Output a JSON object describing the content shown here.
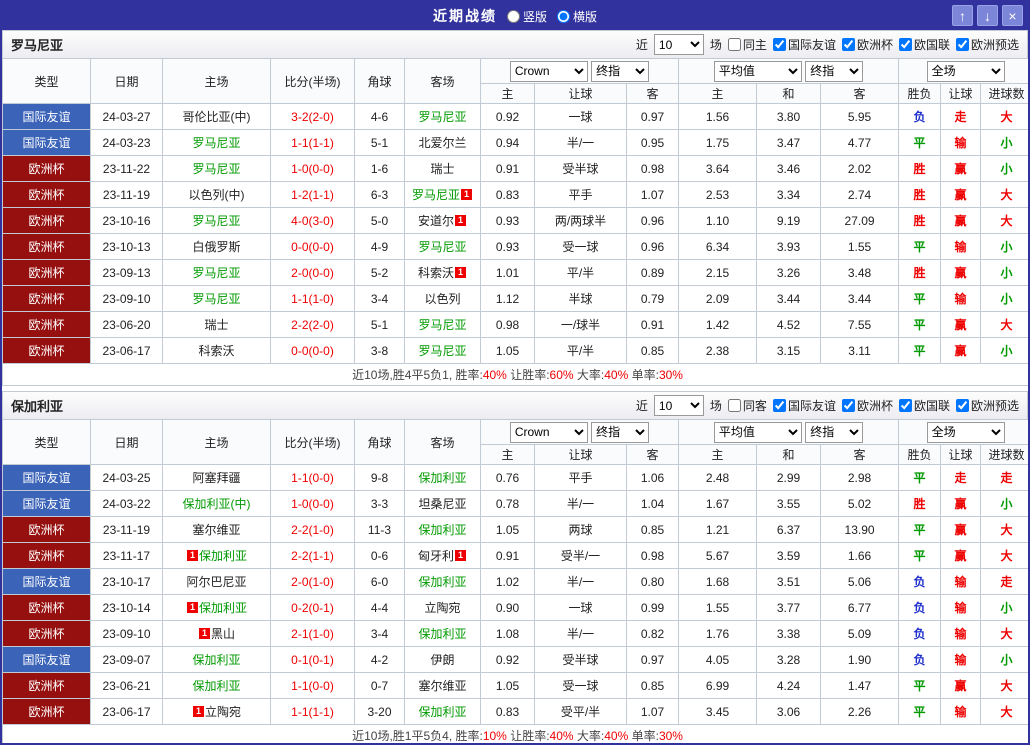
{
  "colors": {
    "topbar_bg": "#32329E",
    "accent_red": "#EE0000",
    "accent_green": "#009900",
    "accent_blue": "#2233CC",
    "type_friendly_bg": "#3B63B8",
    "type_euro_bg": "#971010",
    "team_highlight": "#009900"
  },
  "topbar": {
    "title": "近期战绩",
    "layout_options": [
      {
        "label": "竖版",
        "selected": false
      },
      {
        "label": "横版",
        "selected": true
      }
    ],
    "buttons": {
      "up": "↑",
      "down": "↓",
      "close": "×"
    }
  },
  "table_header": {
    "type": "类型",
    "date": "日期",
    "home": "主场",
    "score": "比分(半场)",
    "corner": "角球",
    "away": "客场",
    "odds_provider": "Crown",
    "odds_stage": "终指",
    "avg": "平均值",
    "avg_stage": "终指",
    "scope": "全场",
    "sub": [
      "主",
      "让球",
      "客",
      "主",
      "和",
      "客",
      "胜负",
      "让球",
      "进球数"
    ]
  },
  "sections": [
    {
      "team": "罗马尼亚",
      "filter": {
        "near": "近",
        "count": "10",
        "games": "场",
        "same": "同主",
        "same_checked": false,
        "comps": [
          {
            "label": "国际友谊",
            "checked": true
          },
          {
            "label": "欧洲杯",
            "checked": true
          },
          {
            "label": "欧国联",
            "checked": true
          },
          {
            "label": "欧洲预选",
            "checked": true
          }
        ]
      },
      "rows": [
        {
          "type": "国际友谊",
          "ts": "friendly",
          "date": "24-03-27",
          "home": {
            "n": "哥伦比亚(中)"
          },
          "score": "3-2(2-0)",
          "corner": "4-6",
          "away": {
            "n": "罗马尼亚",
            "hl": true
          },
          "odds": [
            "0.92",
            "一球",
            "0.97"
          ],
          "avg": [
            "1.56",
            "3.80",
            "5.95"
          ],
          "res": [
            [
              "负",
              "blue"
            ],
            [
              "走",
              "red"
            ],
            [
              "大",
              "red"
            ]
          ]
        },
        {
          "type": "国际友谊",
          "ts": "friendly",
          "date": "24-03-23",
          "home": {
            "n": "罗马尼亚",
            "hl": true
          },
          "score": "1-1(1-1)",
          "corner": "5-1",
          "away": {
            "n": "北爱尔兰"
          },
          "odds": [
            "0.94",
            "半/一",
            "0.95"
          ],
          "avg": [
            "1.75",
            "3.47",
            "4.77"
          ],
          "res": [
            [
              "平",
              "green"
            ],
            [
              "输",
              "red"
            ],
            [
              "小",
              "green"
            ]
          ]
        },
        {
          "type": "欧洲杯",
          "ts": "euro",
          "date": "23-11-22",
          "home": {
            "n": "罗马尼亚",
            "hl": true
          },
          "score": "1-0(0-0)",
          "corner": "1-6",
          "away": {
            "n": "瑞士"
          },
          "odds": [
            "0.91",
            "受半球",
            "0.98"
          ],
          "avg": [
            "3.64",
            "3.46",
            "2.02"
          ],
          "res": [
            [
              "胜",
              "red"
            ],
            [
              "赢",
              "red"
            ],
            [
              "小",
              "green"
            ]
          ]
        },
        {
          "type": "欧洲杯",
          "ts": "euro",
          "date": "23-11-19",
          "home": {
            "n": "以色列(中)"
          },
          "score": "1-2(1-1)",
          "corner": "6-3",
          "away": {
            "n": "罗马尼亚",
            "hl": true,
            "post": true
          },
          "odds": [
            "0.83",
            "平手",
            "1.07"
          ],
          "avg": [
            "2.53",
            "3.34",
            "2.74"
          ],
          "res": [
            [
              "胜",
              "red"
            ],
            [
              "赢",
              "red"
            ],
            [
              "大",
              "red"
            ]
          ]
        },
        {
          "type": "欧洲杯",
          "ts": "euro",
          "date": "23-10-16",
          "home": {
            "n": "罗马尼亚",
            "hl": true
          },
          "score": "4-0(3-0)",
          "corner": "5-0",
          "away": {
            "n": "安道尔",
            "post": true
          },
          "odds": [
            "0.93",
            "两/两球半",
            "0.96"
          ],
          "avg": [
            "1.10",
            "9.19",
            "27.09"
          ],
          "res": [
            [
              "胜",
              "red"
            ],
            [
              "赢",
              "red"
            ],
            [
              "大",
              "red"
            ]
          ]
        },
        {
          "type": "欧洲杯",
          "ts": "euro",
          "date": "23-10-13",
          "home": {
            "n": "白俄罗斯"
          },
          "score": "0-0(0-0)",
          "corner": "4-9",
          "away": {
            "n": "罗马尼亚",
            "hl": true
          },
          "odds": [
            "0.93",
            "受一球",
            "0.96"
          ],
          "avg": [
            "6.34",
            "3.93",
            "1.55"
          ],
          "res": [
            [
              "平",
              "green"
            ],
            [
              "输",
              "red"
            ],
            [
              "小",
              "green"
            ]
          ]
        },
        {
          "type": "欧洲杯",
          "ts": "euro",
          "date": "23-09-13",
          "home": {
            "n": "罗马尼亚",
            "hl": true
          },
          "score": "2-0(0-0)",
          "corner": "5-2",
          "away": {
            "n": "科索沃",
            "post": true
          },
          "odds": [
            "1.01",
            "平/半",
            "0.89"
          ],
          "avg": [
            "2.15",
            "3.26",
            "3.48"
          ],
          "res": [
            [
              "胜",
              "red"
            ],
            [
              "赢",
              "red"
            ],
            [
              "小",
              "green"
            ]
          ]
        },
        {
          "type": "欧洲杯",
          "ts": "euro",
          "date": "23-09-10",
          "home": {
            "n": "罗马尼亚",
            "hl": true
          },
          "score": "1-1(1-0)",
          "corner": "3-4",
          "away": {
            "n": "以色列"
          },
          "odds": [
            "1.12",
            "半球",
            "0.79"
          ],
          "avg": [
            "2.09",
            "3.44",
            "3.44"
          ],
          "res": [
            [
              "平",
              "green"
            ],
            [
              "输",
              "red"
            ],
            [
              "小",
              "green"
            ]
          ]
        },
        {
          "type": "欧洲杯",
          "ts": "euro",
          "date": "23-06-20",
          "home": {
            "n": "瑞士"
          },
          "score": "2-2(2-0)",
          "corner": "5-1",
          "away": {
            "n": "罗马尼亚",
            "hl": true
          },
          "odds": [
            "0.98",
            "一/球半",
            "0.91"
          ],
          "avg": [
            "1.42",
            "4.52",
            "7.55"
          ],
          "res": [
            [
              "平",
              "green"
            ],
            [
              "赢",
              "red"
            ],
            [
              "大",
              "red"
            ]
          ]
        },
        {
          "type": "欧洲杯",
          "ts": "euro",
          "date": "23-06-17",
          "home": {
            "n": "科索沃"
          },
          "score": "0-0(0-0)",
          "corner": "3-8",
          "away": {
            "n": "罗马尼亚",
            "hl": true
          },
          "odds": [
            "1.05",
            "平/半",
            "0.85"
          ],
          "avg": [
            "2.38",
            "3.15",
            "3.11"
          ],
          "res": [
            [
              "平",
              "green"
            ],
            [
              "赢",
              "red"
            ],
            [
              "小",
              "green"
            ]
          ]
        }
      ],
      "summary": [
        [
          "近10场,胜4平5负1, ",
          "dark"
        ],
        [
          "胜率:",
          "dark"
        ],
        [
          "40%",
          "red"
        ],
        [
          " 让胜率:",
          "dark"
        ],
        [
          "60%",
          "red"
        ],
        [
          " 大率:",
          "dark"
        ],
        [
          "40%",
          "red"
        ],
        [
          " 单率:",
          "dark"
        ],
        [
          "30%",
          "red"
        ]
      ]
    },
    {
      "team": "保加利亚",
      "filter": {
        "near": "近",
        "count": "10",
        "games": "场",
        "same": "同客",
        "same_checked": false,
        "comps": [
          {
            "label": "国际友谊",
            "checked": true
          },
          {
            "label": "欧洲杯",
            "checked": true
          },
          {
            "label": "欧国联",
            "checked": true
          },
          {
            "label": "欧洲预选",
            "checked": true
          }
        ]
      },
      "rows": [
        {
          "type": "国际友谊",
          "ts": "friendly",
          "date": "24-03-25",
          "home": {
            "n": "阿塞拜疆"
          },
          "score": "1-1(0-0)",
          "corner": "9-8",
          "away": {
            "n": "保加利亚",
            "hl": true
          },
          "odds": [
            "0.76",
            "平手",
            "1.06"
          ],
          "avg": [
            "2.48",
            "2.99",
            "2.98"
          ],
          "res": [
            [
              "平",
              "green"
            ],
            [
              "走",
              "red"
            ],
            [
              "走",
              "red"
            ]
          ]
        },
        {
          "type": "国际友谊",
          "ts": "friendly",
          "date": "24-03-22",
          "home": {
            "n": "保加利亚(中)",
            "hl": true
          },
          "score": "1-0(0-0)",
          "corner": "3-3",
          "away": {
            "n": "坦桑尼亚"
          },
          "odds": [
            "0.78",
            "半/一",
            "1.04"
          ],
          "avg": [
            "1.67",
            "3.55",
            "5.02"
          ],
          "res": [
            [
              "胜",
              "red"
            ],
            [
              "赢",
              "red"
            ],
            [
              "小",
              "green"
            ]
          ]
        },
        {
          "type": "欧洲杯",
          "ts": "euro",
          "date": "23-11-19",
          "home": {
            "n": "塞尔维亚"
          },
          "score": "2-2(1-0)",
          "corner": "11-3",
          "away": {
            "n": "保加利亚",
            "hl": true
          },
          "odds": [
            "1.05",
            "两球",
            "0.85"
          ],
          "avg": [
            "1.21",
            "6.37",
            "13.90"
          ],
          "res": [
            [
              "平",
              "green"
            ],
            [
              "赢",
              "red"
            ],
            [
              "大",
              "red"
            ]
          ]
        },
        {
          "type": "欧洲杯",
          "ts": "euro",
          "date": "23-11-17",
          "home": {
            "n": "保加利亚",
            "hl": true,
            "pre": true
          },
          "score": "2-2(1-1)",
          "corner": "0-6",
          "away": {
            "n": "匈牙利",
            "post": true
          },
          "odds": [
            "0.91",
            "受半/一",
            "0.98"
          ],
          "avg": [
            "5.67",
            "3.59",
            "1.66"
          ],
          "res": [
            [
              "平",
              "green"
            ],
            [
              "赢",
              "red"
            ],
            [
              "大",
              "red"
            ]
          ]
        },
        {
          "type": "国际友谊",
          "ts": "friendly",
          "date": "23-10-17",
          "home": {
            "n": "阿尔巴尼亚"
          },
          "score": "2-0(1-0)",
          "corner": "6-0",
          "away": {
            "n": "保加利亚",
            "hl": true
          },
          "odds": [
            "1.02",
            "半/一",
            "0.80"
          ],
          "avg": [
            "1.68",
            "3.51",
            "5.06"
          ],
          "res": [
            [
              "负",
              "blue"
            ],
            [
              "输",
              "red"
            ],
            [
              "走",
              "red"
            ]
          ]
        },
        {
          "type": "欧洲杯",
          "ts": "euro",
          "date": "23-10-14",
          "home": {
            "n": "保加利亚",
            "hl": true,
            "pre": true
          },
          "score": "0-2(0-1)",
          "corner": "4-4",
          "away": {
            "n": "立陶宛"
          },
          "odds": [
            "0.90",
            "一球",
            "0.99"
          ],
          "avg": [
            "1.55",
            "3.77",
            "6.77"
          ],
          "res": [
            [
              "负",
              "blue"
            ],
            [
              "输",
              "red"
            ],
            [
              "小",
              "green"
            ]
          ]
        },
        {
          "type": "欧洲杯",
          "ts": "euro",
          "date": "23-09-10",
          "home": {
            "n": "黑山",
            "pre": true
          },
          "score": "2-1(1-0)",
          "corner": "3-4",
          "away": {
            "n": "保加利亚",
            "hl": true
          },
          "odds": [
            "1.08",
            "半/一",
            "0.82"
          ],
          "avg": [
            "1.76",
            "3.38",
            "5.09"
          ],
          "res": [
            [
              "负",
              "blue"
            ],
            [
              "输",
              "red"
            ],
            [
              "大",
              "red"
            ]
          ]
        },
        {
          "type": "国际友谊",
          "ts": "friendly",
          "date": "23-09-07",
          "home": {
            "n": "保加利亚",
            "hl": true
          },
          "score": "0-1(0-1)",
          "corner": "4-2",
          "away": {
            "n": "伊朗"
          },
          "odds": [
            "0.92",
            "受半球",
            "0.97"
          ],
          "avg": [
            "4.05",
            "3.28",
            "1.90"
          ],
          "res": [
            [
              "负",
              "blue"
            ],
            [
              "输",
              "red"
            ],
            [
              "小",
              "green"
            ]
          ]
        },
        {
          "type": "欧洲杯",
          "ts": "euro",
          "date": "23-06-21",
          "home": {
            "n": "保加利亚",
            "hl": true
          },
          "score": "1-1(0-0)",
          "corner": "0-7",
          "away": {
            "n": "塞尔维亚"
          },
          "odds": [
            "1.05",
            "受一球",
            "0.85"
          ],
          "avg": [
            "6.99",
            "4.24",
            "1.47"
          ],
          "res": [
            [
              "平",
              "green"
            ],
            [
              "赢",
              "red"
            ],
            [
              "大",
              "red"
            ]
          ]
        },
        {
          "type": "欧洲杯",
          "ts": "euro",
          "date": "23-06-17",
          "home": {
            "n": "立陶宛",
            "pre": true
          },
          "score": "1-1(1-1)",
          "corner": "3-20",
          "away": {
            "n": "保加利亚",
            "hl": true
          },
          "odds": [
            "0.83",
            "受平/半",
            "1.07"
          ],
          "avg": [
            "3.45",
            "3.06",
            "2.26"
          ],
          "res": [
            [
              "平",
              "green"
            ],
            [
              "输",
              "red"
            ],
            [
              "大",
              "red"
            ]
          ]
        }
      ],
      "summary": [
        [
          "近10场,胜1平5负4, ",
          "dark"
        ],
        [
          "胜率:",
          "dark"
        ],
        [
          "10%",
          "red"
        ],
        [
          " 让胜率:",
          "dark"
        ],
        [
          "40%",
          "red"
        ],
        [
          " 大率:",
          "dark"
        ],
        [
          "40%",
          "red"
        ],
        [
          " 单率:",
          "dark"
        ],
        [
          "30%",
          "red"
        ]
      ]
    }
  ]
}
